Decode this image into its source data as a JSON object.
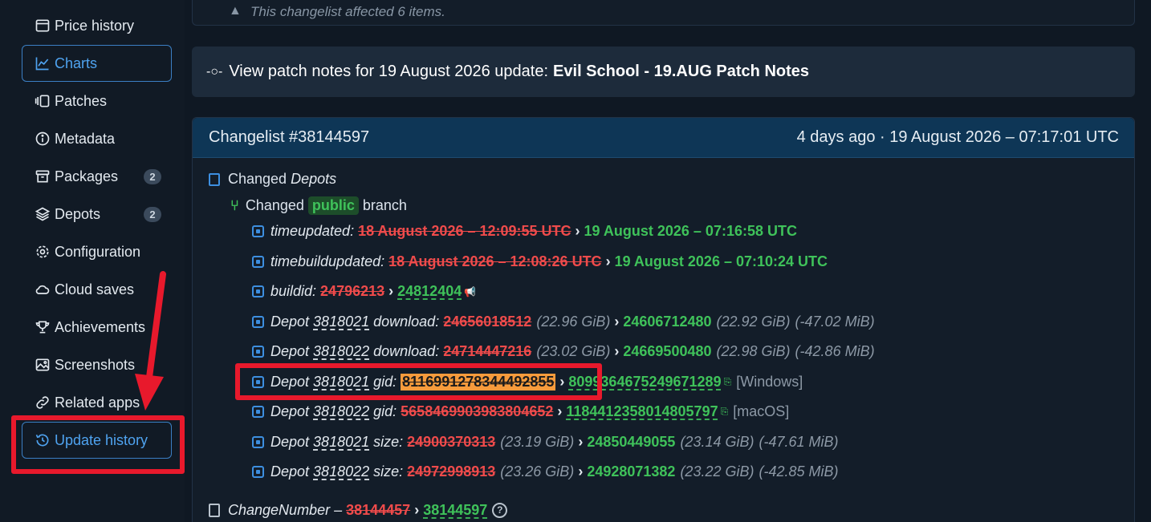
{
  "sidebar": {
    "items": [
      {
        "label": "Price history",
        "icon": "price-history-icon"
      },
      {
        "label": "Charts",
        "icon": "chart-icon"
      },
      {
        "label": "Patches",
        "icon": "patches-icon"
      },
      {
        "label": "Metadata",
        "icon": "info-icon"
      },
      {
        "label": "Packages",
        "icon": "package-icon",
        "badge": "2"
      },
      {
        "label": "Depots",
        "icon": "layers-icon",
        "badge": "2"
      },
      {
        "label": "Configuration",
        "icon": "gear-icon"
      },
      {
        "label": "Cloud saves",
        "icon": "cloud-icon"
      },
      {
        "label": "Achievements",
        "icon": "trophy-icon"
      },
      {
        "label": "Screenshots",
        "icon": "image-icon"
      },
      {
        "label": "Related apps",
        "icon": "link-icon"
      },
      {
        "label": "Update history",
        "icon": "history-icon"
      }
    ]
  },
  "top_message": "This changelist affected 6 items.",
  "patch_notes": {
    "prefix": "View patch notes for 19 August 2026 update:",
    "title": "Evil School - 19.AUG Patch Notes"
  },
  "changelist": {
    "title": "Changelist #38144597",
    "time": "4 days ago · 19 August 2026 – 07:17:01 UTC",
    "changed_label": "Changed",
    "depots_label": "Depots",
    "branch_prefix": "Changed",
    "branch_name": "public",
    "branch_suffix": "branch",
    "rows": {
      "timeupdated": {
        "key": "timeupdated:",
        "old": "18 August 2026 – 12:09:55 UTC",
        "new": "19 August 2026 – 07:16:58 UTC"
      },
      "timebuildupdated": {
        "key": "timebuildupdated:",
        "old": "18 August 2026 – 12:08:26 UTC",
        "new": "19 August 2026 – 07:10:24 UTC"
      },
      "buildid": {
        "key": "buildid:",
        "old": "24796213",
        "new": "24812404"
      },
      "dl1": {
        "pre": "Depot",
        "depot": "3818021",
        "key": "download:",
        "old": "24656018512",
        "old_size": "(22.96 GiB)",
        "new": "24606712480",
        "new_size": "(22.92 GiB)",
        "diff": "(-47.02 MiB)"
      },
      "dl2": {
        "pre": "Depot",
        "depot": "3818022",
        "key": "download:",
        "old": "24714447216",
        "old_size": "(23.02 GiB)",
        "new": "24669500480",
        "new_size": "(22.98 GiB)",
        "diff": "(-42.86 MiB)"
      },
      "gid1": {
        "pre": "Depot",
        "depot": "3818021",
        "key": "gid:",
        "old": "8116991278344492855",
        "new": "8099364675249671289",
        "platform": "[Windows]"
      },
      "gid2": {
        "pre": "Depot",
        "depot": "3818022",
        "key": "gid:",
        "old": "5658469903983804652",
        "new": "1184412358014805797",
        "platform": "[macOS]"
      },
      "size1": {
        "pre": "Depot",
        "depot": "3818021",
        "key": "size:",
        "old": "24900370313",
        "old_size": "(23.19 GiB)",
        "new": "24850449055",
        "new_size": "(23.14 GiB)",
        "diff": "(-47.61 MiB)"
      },
      "size2": {
        "pre": "Depot",
        "depot": "3818022",
        "key": "size:",
        "old": "24972998913",
        "old_size": "(23.26 GiB)",
        "new": "24928071382",
        "new_size": "(23.22 GiB)",
        "diff": "(-42.85 MiB)"
      },
      "changenumber": {
        "key": "ChangeNumber –",
        "old": "38144457",
        "new": "38144597"
      }
    }
  },
  "arrow_glyph": "›",
  "colors": {
    "accent": "#4fa3f0",
    "removed": "#ef4b4b",
    "added": "#3fc25a",
    "highlight": "#f79b3c",
    "annotation": "#e8192c"
  }
}
